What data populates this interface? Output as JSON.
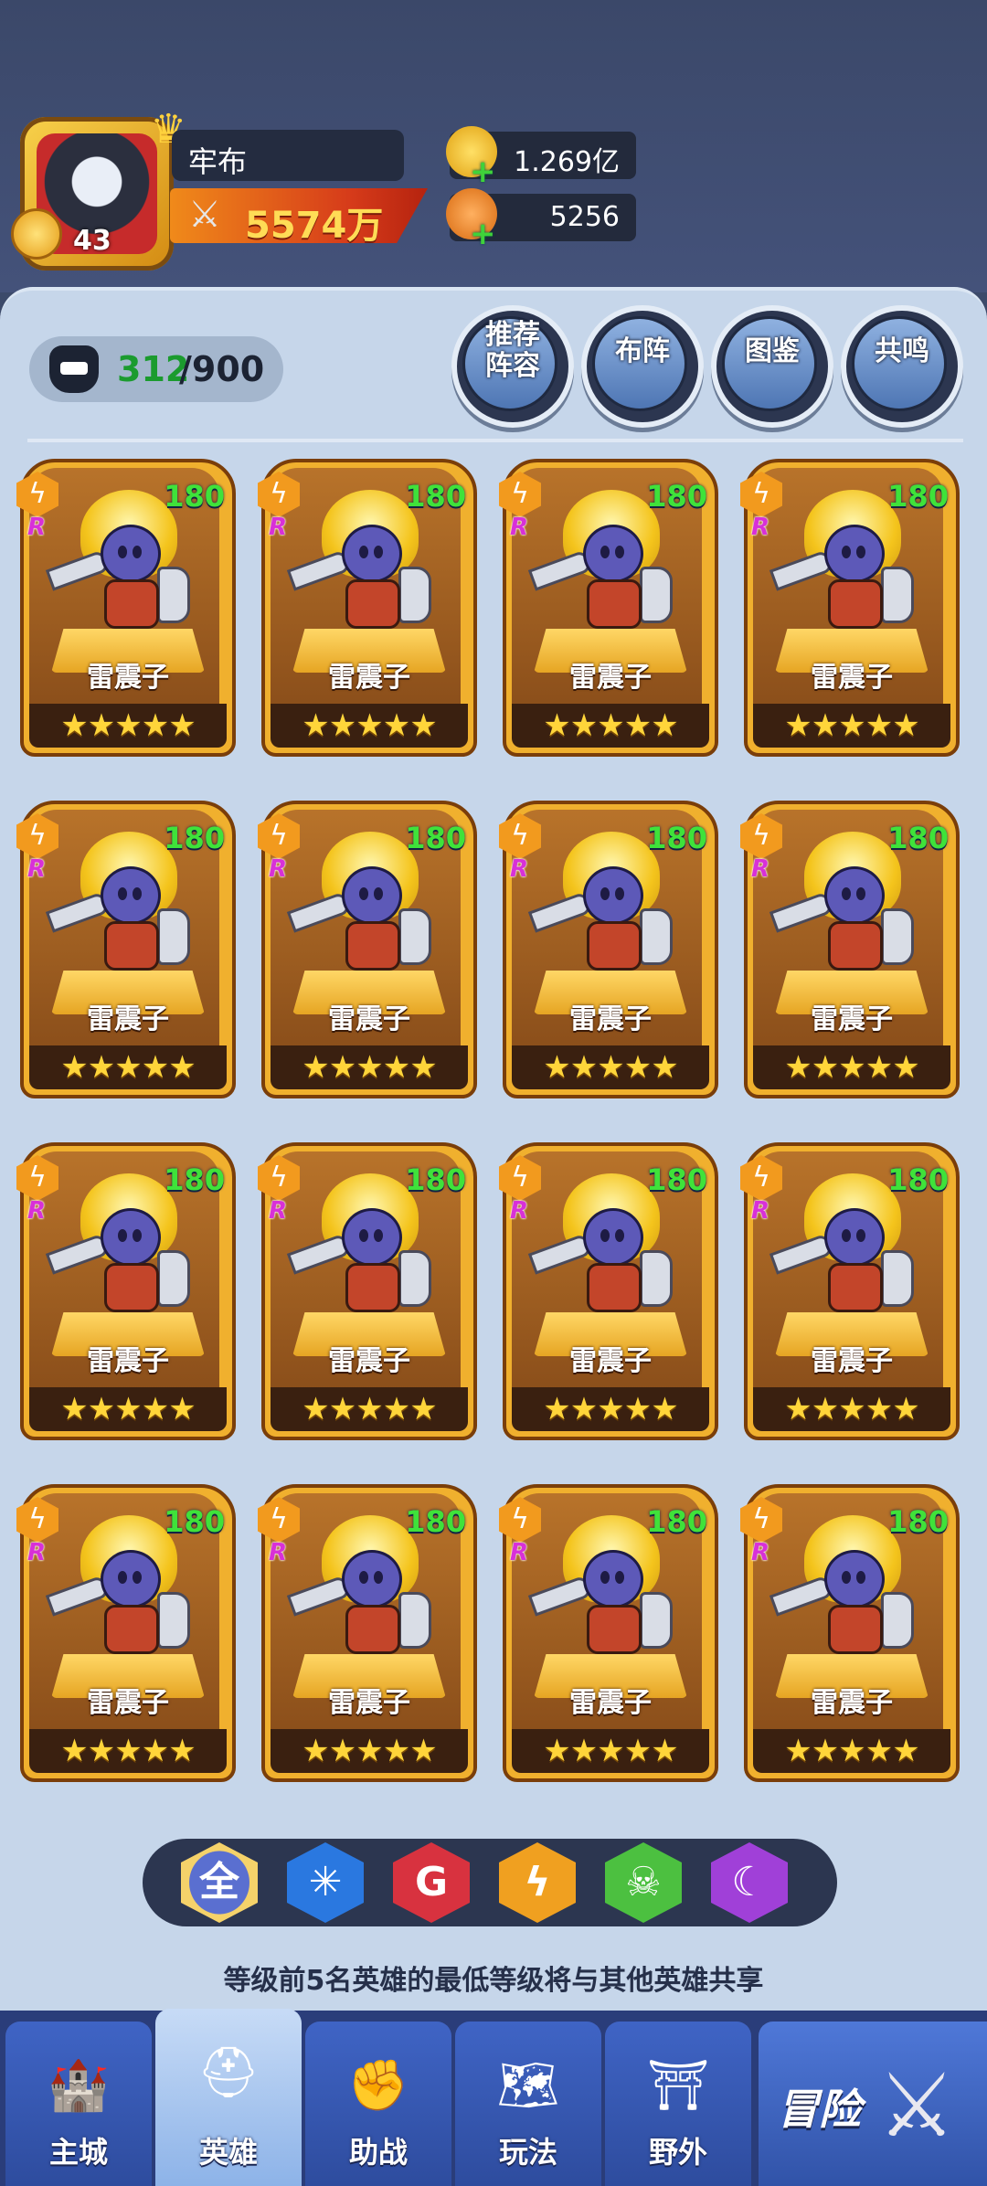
{
  "player": {
    "name": "牢布",
    "level": "43",
    "power": "5574万"
  },
  "resources": {
    "gold": "1.269亿",
    "gems": "5256"
  },
  "roster": {
    "current": "312",
    "separator_max": "/900"
  },
  "actions": [
    {
      "label": "推荐阵容",
      "name": "recommend-lineup-button"
    },
    {
      "label": "布阵",
      "name": "formation-button"
    },
    {
      "label": "图鉴",
      "name": "codex-button"
    },
    {
      "label": "共鸣",
      "name": "resonance-button"
    }
  ],
  "heroes": [
    {
      "name": "雷震子",
      "level": "180",
      "rarity": "R",
      "element": "lightning",
      "stars": 5
    },
    {
      "name": "雷震子",
      "level": "180",
      "rarity": "R",
      "element": "lightning",
      "stars": 5
    },
    {
      "name": "雷震子",
      "level": "180",
      "rarity": "R",
      "element": "lightning",
      "stars": 5
    },
    {
      "name": "雷震子",
      "level": "180",
      "rarity": "R",
      "element": "lightning",
      "stars": 5
    },
    {
      "name": "雷震子",
      "level": "180",
      "rarity": "R",
      "element": "lightning",
      "stars": 5
    },
    {
      "name": "雷震子",
      "level": "180",
      "rarity": "R",
      "element": "lightning",
      "stars": 5
    },
    {
      "name": "雷震子",
      "level": "180",
      "rarity": "R",
      "element": "lightning",
      "stars": 5
    },
    {
      "name": "雷震子",
      "level": "180",
      "rarity": "R",
      "element": "lightning",
      "stars": 5
    },
    {
      "name": "雷震子",
      "level": "180",
      "rarity": "R",
      "element": "lightning",
      "stars": 5
    },
    {
      "name": "雷震子",
      "level": "180",
      "rarity": "R",
      "element": "lightning",
      "stars": 5
    },
    {
      "name": "雷震子",
      "level": "180",
      "rarity": "R",
      "element": "lightning",
      "stars": 5
    },
    {
      "name": "雷震子",
      "level": "180",
      "rarity": "R",
      "element": "lightning",
      "stars": 5
    },
    {
      "name": "雷震子",
      "level": "180",
      "rarity": "R",
      "element": "lightning",
      "stars": 5
    },
    {
      "name": "雷震子",
      "level": "180",
      "rarity": "R",
      "element": "lightning",
      "stars": 5
    },
    {
      "name": "雷震子",
      "level": "180",
      "rarity": "R",
      "element": "lightning",
      "stars": 5
    },
    {
      "name": "雷震子",
      "level": "180",
      "rarity": "R",
      "element": "lightning",
      "stars": 5
    }
  ],
  "filters": [
    {
      "label": "全",
      "icon": "all-icon",
      "color": "#5a6fd0",
      "selected": true
    },
    {
      "label": "✳",
      "icon": "ice-icon",
      "color": "#2a78e0",
      "selected": false
    },
    {
      "label": "G",
      "icon": "fire-icon",
      "color": "#d8323f",
      "selected": false
    },
    {
      "label": "ϟ",
      "icon": "lightning-icon",
      "color": "#f0a020",
      "selected": false
    },
    {
      "label": "☠",
      "icon": "poison-icon",
      "color": "#4cc040",
      "selected": false
    },
    {
      "label": "☾",
      "icon": "dark-icon",
      "color": "#a040d8",
      "selected": false
    }
  ],
  "hint": "等级前5名英雄的最低等级将与其他英雄共享",
  "nav": [
    {
      "label": "主城",
      "icon": "castle-icon",
      "glyph": "🏰",
      "active": false
    },
    {
      "label": "英雄",
      "icon": "hero-helmet-icon",
      "glyph": "⛑",
      "active": true
    },
    {
      "label": "助战",
      "icon": "fist-icon",
      "glyph": "✊",
      "active": false
    },
    {
      "label": "玩法",
      "icon": "map-icon",
      "glyph": "🗺",
      "active": false
    },
    {
      "label": "野外",
      "icon": "portal-icon",
      "glyph": "⛩",
      "active": false
    }
  ],
  "adventure": {
    "label": "冒险",
    "icon": "crossed-swords-icon"
  },
  "colors": {
    "level_green": "#3fe23a",
    "power_gold": "#ffdc56",
    "panel": "#c6d6ea",
    "nav": "#2a3d7a"
  }
}
